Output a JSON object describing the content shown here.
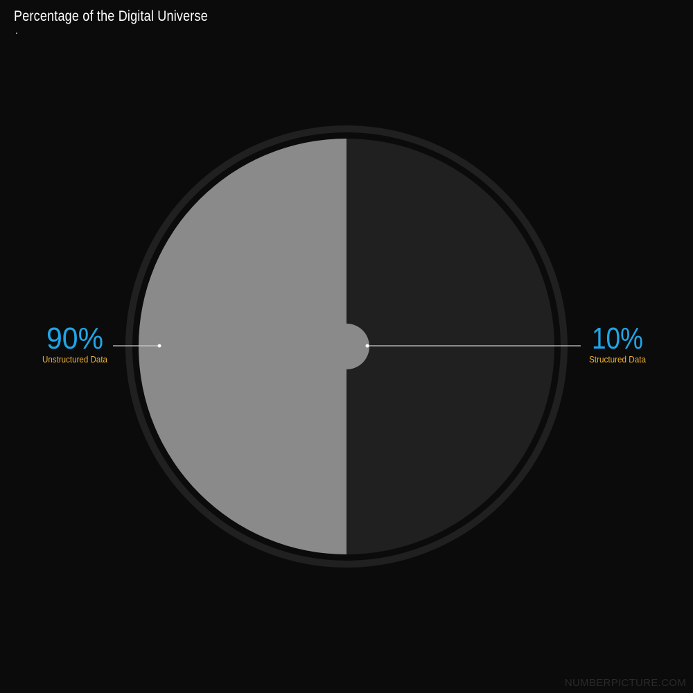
{
  "page": {
    "title": "Percentage of the Digital Universe",
    "watermark": "NUMBERPICTURE.COM"
  },
  "chart_data": {
    "type": "pie",
    "title": "Percentage of the Digital Universe",
    "slices": [
      {
        "label": "Unstructured Data",
        "value": 90,
        "display": "90%",
        "color": "#8a8a8a"
      },
      {
        "label": "Structured Data",
        "value": 10,
        "display": "10%",
        "color": "#202020"
      }
    ],
    "colors": {
      "background": "#0b0b0b",
      "ring": "#202020",
      "percent_text": "#1fa6e8",
      "label_text": "#f2b232",
      "leader_line": "#cccccc"
    }
  }
}
